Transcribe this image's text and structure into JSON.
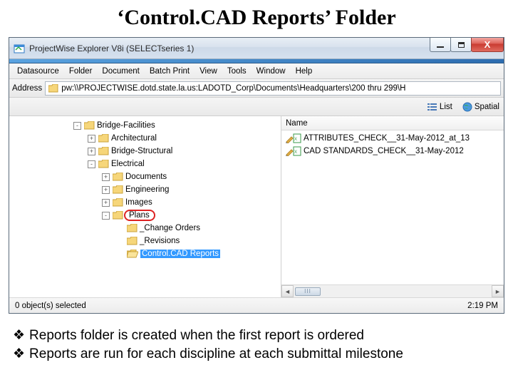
{
  "slide": {
    "title": "‘Control.CAD Reports’ Folder"
  },
  "window": {
    "title": "ProjectWise Explorer V8i (SELECTseries 1)"
  },
  "menubar": [
    "Datasource",
    "Folder",
    "Document",
    "Batch Print",
    "View",
    "Tools",
    "Window",
    "Help"
  ],
  "address": {
    "label": "Address",
    "path": "pw:\\\\PROJECTWISE.dotd.state.la.us:LADOTD_Corp\\Documents\\Headquarters\\200 thru 299\\H"
  },
  "toolbar": {
    "list": "List",
    "spatial": "Spatial"
  },
  "tree": {
    "root": {
      "label": "Bridge-Facilities",
      "expander": "-"
    },
    "arch": {
      "label": "Architectural",
      "expander": "+"
    },
    "struct": {
      "label": "Bridge-Structural",
      "expander": "+"
    },
    "elec": {
      "label": "Electrical",
      "expander": "-"
    },
    "docs": {
      "label": "Documents",
      "expander": "+"
    },
    "eng": {
      "label": "Engineering",
      "expander": "+"
    },
    "img": {
      "label": "Images",
      "expander": "+"
    },
    "plans": {
      "label": "Plans",
      "expander": "-"
    },
    "chg": {
      "label": "_Change Orders"
    },
    "rev": {
      "label": "_Revisions"
    },
    "cad": {
      "label": "Control.CAD Reports"
    }
  },
  "list": {
    "header": "Name",
    "items": [
      "ATTRIBUTES_CHECK__31-May-2012_at_13",
      "CAD STANDARDS_CHECK__31-May-2012"
    ]
  },
  "status": {
    "left": "0 object(s) selected",
    "right": "2:19 PM"
  },
  "bullets": [
    "Reports folder is created when the first report is ordered",
    "Reports are run for each discipline at each submittal milestone"
  ]
}
